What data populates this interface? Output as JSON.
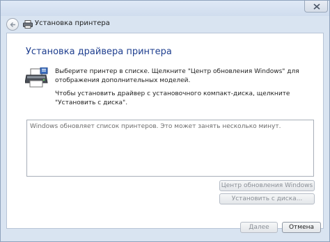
{
  "window": {
    "nav_title": "Установка принтера",
    "heading": "Установка драйвера принтера"
  },
  "instructions": {
    "line1": "Выберите принтер в списке. Щелкните \"Центр обновления Windows\" для отображения дополнительных моделей.",
    "line2": "Чтобы установить драйвер с установочного компакт-диска, щелкните \"Установить с диска\"."
  },
  "printer_list": {
    "status": "Windows обновляет список принтеров. Это может занять несколько минут."
  },
  "buttons": {
    "windows_update": "Центр обновления Windows",
    "have_disk": "Установить с диска...",
    "next": "Далее",
    "cancel": "Отмена"
  },
  "icons": {
    "back": "back-arrow-icon",
    "nav_printer": "printer-icon",
    "main_printer": "printer-install-icon",
    "close": "close-icon"
  }
}
